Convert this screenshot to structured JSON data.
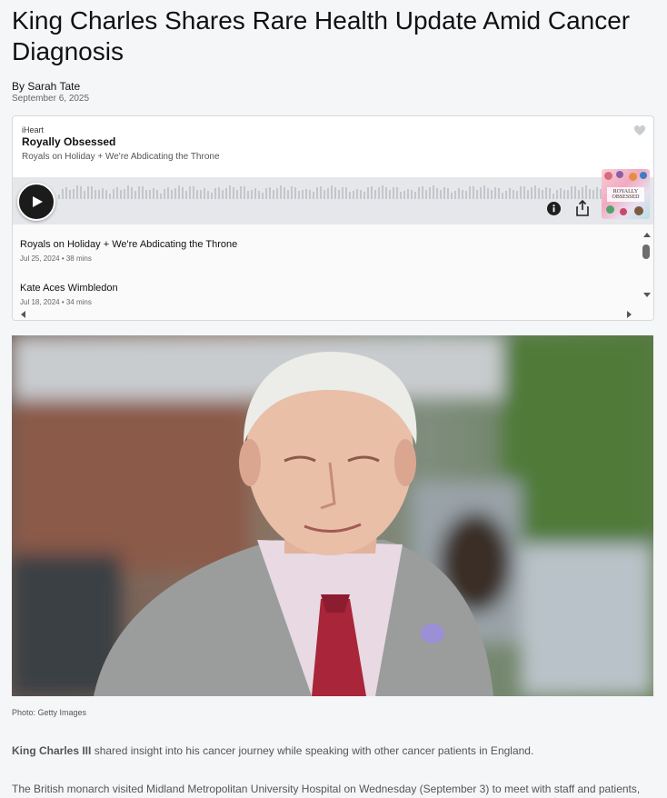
{
  "article": {
    "headline": "King Charles Shares Rare Health Update Amid Cancer Diagnosis",
    "byline": "By Sarah Tate",
    "date": "September 6, 2025"
  },
  "player": {
    "brand": "iHeart",
    "show": "Royally Obsessed",
    "current_episode": "Royals on Holiday + We're Abdicating the Throne",
    "cover_text": "ROYALLY OBSESSED",
    "icons": [
      "play-icon",
      "info-icon",
      "share-icon",
      "iheart-logo-icon"
    ],
    "episodes": [
      {
        "title": "Royals on Holiday + We're Abdicating the Throne",
        "meta": "Jul 25, 2024 • 38 mins"
      },
      {
        "title": "Kate Aces Wimbledon",
        "meta": "Jul 18, 2024 • 34 mins"
      }
    ]
  },
  "photo": {
    "caption": "Photo: Getty Images"
  },
  "body": {
    "p1_bold": "King Charles III",
    "p1_rest": " shared insight into his cancer journey while speaking with other cancer patients in England.",
    "p2": "The British monarch visited Midland Metropolitan University Hospital on Wednesday (September 3) to meet with staff and patients,"
  }
}
